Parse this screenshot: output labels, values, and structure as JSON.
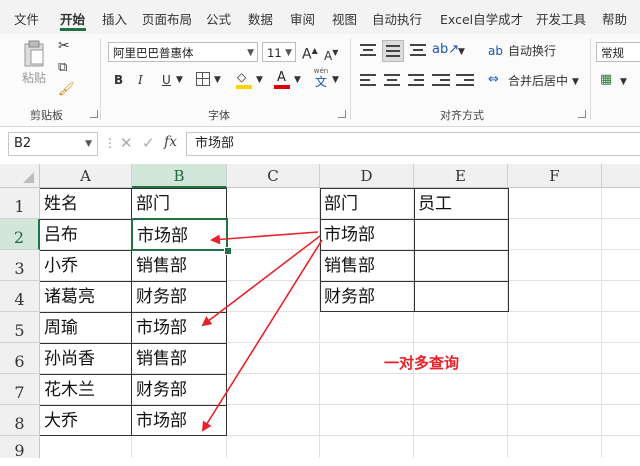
{
  "menu": {
    "tabs": [
      "文件",
      "开始",
      "插入",
      "页面布局",
      "公式",
      "数据",
      "审阅",
      "视图",
      "自动执行",
      "Excel自学成才",
      "开发工具",
      "帮助"
    ],
    "active_tab": "开始"
  },
  "ribbon": {
    "clipboard": {
      "paste_label": "粘贴",
      "group_label": "剪贴板"
    },
    "font": {
      "font_name": "阿里巴巴普惠体",
      "font_size": "11",
      "bold": "B",
      "italic": "I",
      "underline": "U",
      "font_color_glyph": "A",
      "phonetic_glyph": "文",
      "phonetic_small": "wén",
      "group_label": "字体"
    },
    "alignment": {
      "wrap_text": "自动换行",
      "merge_center": "合并后居中",
      "group_label": "对齐方式"
    },
    "number": {
      "format": "常规"
    }
  },
  "formula_bar": {
    "name_box": "B2",
    "fx": "fx",
    "value": "市场部"
  },
  "grid": {
    "columns": [
      "A",
      "B",
      "C",
      "D",
      "E",
      "F"
    ],
    "rows": [
      "1",
      "2",
      "3",
      "4",
      "5",
      "6",
      "7",
      "8",
      "9"
    ],
    "table_left": {
      "header": [
        "姓名",
        "部门"
      ],
      "rows": [
        [
          "吕布",
          "市场部"
        ],
        [
          "小乔",
          "销售部"
        ],
        [
          "诸葛亮",
          "财务部"
        ],
        [
          "周瑜",
          "市场部"
        ],
        [
          "孙尚香",
          "销售部"
        ],
        [
          "花木兰",
          "财务部"
        ],
        [
          "大乔",
          "市场部"
        ]
      ]
    },
    "table_right": {
      "header": [
        "部门",
        "员工"
      ],
      "rows": [
        "市场部",
        "销售部",
        "财务部"
      ]
    },
    "selected_cell": "B2"
  },
  "annotation": "一对多查询",
  "colors": {
    "accent": "#217346",
    "arrow": "#e8222a"
  }
}
